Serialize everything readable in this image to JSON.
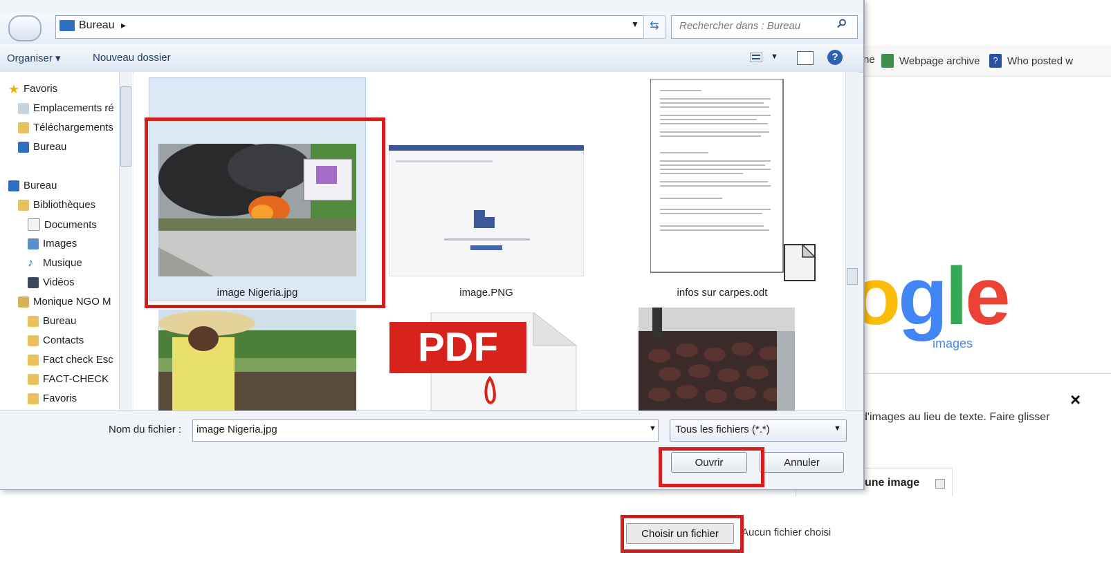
{
  "dialog": {
    "address": "Bureau",
    "search_placeholder": "Rechercher dans : Bureau",
    "toolbar": {
      "organize": "Organiser ▾",
      "new_folder": "Nouveau dossier"
    },
    "nav_items": [
      {
        "label": "Favoris",
        "icon": "star-icon"
      },
      {
        "label": "Emplacements ré",
        "icon": "places-icon"
      },
      {
        "label": "Téléchargements",
        "icon": "downloads-icon"
      },
      {
        "label": "Bureau",
        "icon": "desktop-icon"
      },
      {
        "label": "Bureau",
        "icon": "desktop-icon"
      },
      {
        "label": "Bibliothèques",
        "icon": "libraries-icon"
      },
      {
        "label": "Documents",
        "icon": "document-icon"
      },
      {
        "label": "Images",
        "icon": "pictures-icon"
      },
      {
        "label": "Musique",
        "icon": "music-icon"
      },
      {
        "label": "Vidéos",
        "icon": "video-icon"
      },
      {
        "label": "Monique NGO M",
        "icon": "user-folder-icon"
      },
      {
        "label": "Bureau",
        "icon": "desktop-icon"
      },
      {
        "label": "Contacts",
        "icon": "contacts-icon"
      },
      {
        "label": "Fact check Esc",
        "icon": "folder-icon"
      },
      {
        "label": "FACT-CHECK",
        "icon": "folder-icon"
      },
      {
        "label": "Favoris",
        "icon": "star-icon"
      }
    ],
    "files": [
      {
        "name": "image Nigeria.jpg",
        "selected": true
      },
      {
        "name": "image.PNG",
        "selected": false
      },
      {
        "name": "infos sur carpes.odt",
        "selected": false
      },
      {
        "name": "",
        "selected": false
      },
      {
        "name": "",
        "selected": false
      },
      {
        "name": "",
        "selected": false
      }
    ],
    "pdf_label": "PDF",
    "filename_label": "Nom du fichier :",
    "filename_value": "image Nigeria.jpg",
    "filter": "Tous les fichiers (*.*)",
    "open_button": "Ouvrir",
    "cancel_button": "Annuler"
  },
  "browser": {
    "bookmarks": [
      {
        "label": "ne",
        "icon": "none"
      },
      {
        "label": "Webpage archive",
        "icon": "archive-icon"
      },
      {
        "label": "Who posted w",
        "icon": "question-icon"
      }
    ],
    "logo_text": "ogle",
    "logo_sub": "images",
    "drag_text": "d'images au lieu de texte. Faire glisser",
    "upload_tab": "une image",
    "choose_file": "Choisir un fichier",
    "no_file": "Aucun fichier choisi",
    "close": "×"
  }
}
